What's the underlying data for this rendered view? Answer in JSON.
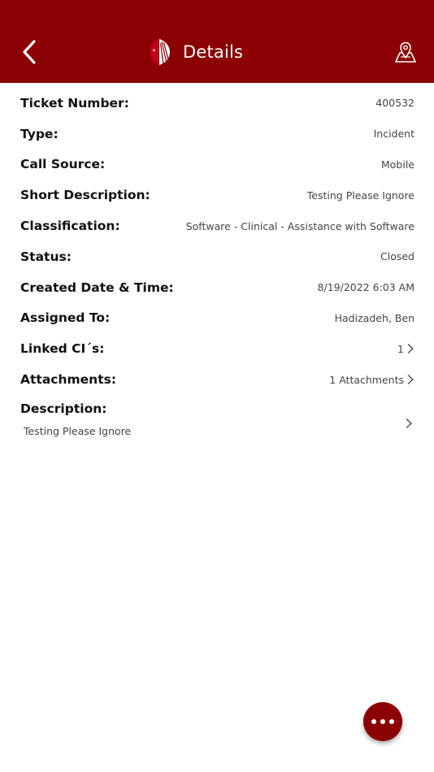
{
  "header": {
    "title": "Details",
    "background_color": "#8b0000"
  },
  "details": {
    "rows": [
      {
        "label": "Ticket Number:",
        "value": "400532"
      },
      {
        "label": "Type:",
        "value": "Incident"
      },
      {
        "label": "Call Source:",
        "value": "Mobile"
      },
      {
        "label": "Short Description:",
        "value": "Testing Please Ignore"
      },
      {
        "label": "Classification:",
        "value": "Software - Clinical - Assistance with Software"
      },
      {
        "label": "Status:",
        "value": "Closed"
      },
      {
        "label": "Created Date & Time:",
        "value": "8/19/2022 6:03 AM"
      },
      {
        "label": "Assigned To:",
        "value": "Hadizadeh, Ben"
      },
      {
        "label": "Linked CI´s:",
        "value": "1"
      },
      {
        "label": "Attachments:",
        "value": "1 Attachments"
      }
    ],
    "description": {
      "label": "Description:",
      "text": "Testing Please Ignore"
    }
  },
  "icons": {
    "back": "chevron-left-icon",
    "logo": "app-logo-icon",
    "map": "map-pin-icon",
    "more": "more-horizontal-icon"
  }
}
